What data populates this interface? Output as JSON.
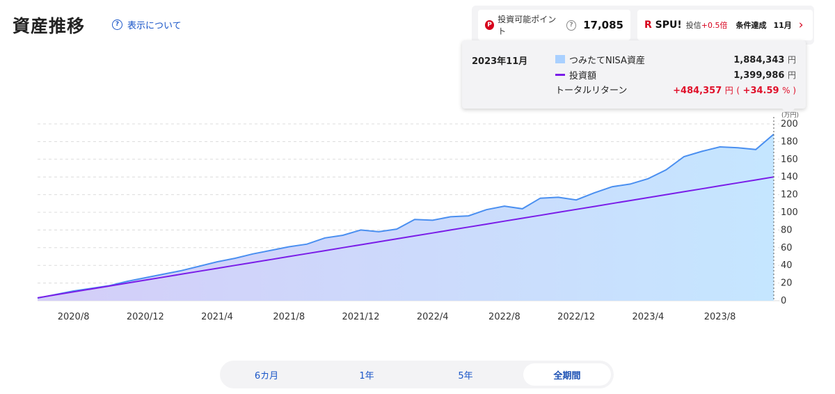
{
  "header": {
    "title": "資産推移",
    "about_link": "表示について"
  },
  "points_card": {
    "label": "投資可能ポイント",
    "value": "17,085"
  },
  "spu_card": {
    "logo": "SPU!",
    "type": "投信",
    "plus": "+0.5倍",
    "condition": "条件達成",
    "month": "11月"
  },
  "tooltip": {
    "date": "2023年11月",
    "asset_label": "つみたてNISA資産",
    "asset_value": "1,884,343",
    "invest_label": "投資額",
    "invest_value": "1,399,986",
    "return_label": "トータルリターン",
    "return_value": "+484,357",
    "return_pct": "+34.59",
    "unit_yen": "円",
    "pct_unit": "%"
  },
  "chart_data": {
    "type": "area",
    "unit_label": "(万円)",
    "ylim": [
      0,
      200
    ],
    "y_ticks": [
      0,
      20,
      40,
      60,
      80,
      100,
      120,
      140,
      160,
      180,
      200
    ],
    "x_tick_labels": [
      "2020/8",
      "2020/12",
      "2021/4",
      "2021/8",
      "2021/12",
      "2022/4",
      "2022/8",
      "2022/12",
      "2023/4",
      "2023/8"
    ],
    "x_tick_index": [
      2,
      6,
      10,
      14,
      18,
      22,
      26,
      30,
      34,
      38
    ],
    "categories": [
      "2020/6",
      "2020/7",
      "2020/8",
      "2020/9",
      "2020/10",
      "2020/11",
      "2020/12",
      "2021/1",
      "2021/2",
      "2021/3",
      "2021/4",
      "2021/5",
      "2021/6",
      "2021/7",
      "2021/8",
      "2021/9",
      "2021/10",
      "2021/11",
      "2021/12",
      "2022/1",
      "2022/2",
      "2022/3",
      "2022/4",
      "2022/5",
      "2022/6",
      "2022/7",
      "2022/8",
      "2022/9",
      "2022/10",
      "2022/11",
      "2022/12",
      "2023/1",
      "2023/2",
      "2023/3",
      "2023/4",
      "2023/5",
      "2023/6",
      "2023/7",
      "2023/8",
      "2023/9",
      "2023/10",
      "2023/11"
    ],
    "series": [
      {
        "name": "つみたてNISA資産",
        "color": "#4a8ff0",
        "values": [
          3,
          7,
          11,
          14,
          17,
          22,
          26,
          30,
          34,
          39,
          44,
          48,
          53,
          57,
          61,
          64,
          71,
          74,
          80,
          78,
          81,
          92,
          91,
          95,
          96,
          103,
          107,
          104,
          116,
          117,
          114,
          122,
          129,
          132,
          138,
          148,
          163,
          169,
          174,
          173,
          171,
          188.4
        ]
      },
      {
        "name": "投資額",
        "color": "#7a1de8",
        "values": [
          3.3,
          6.7,
          10.0,
          13.3,
          16.6,
          20.0,
          23.3,
          26.6,
          30.0,
          33.3,
          36.6,
          40.0,
          43.3,
          46.6,
          50.0,
          53.3,
          56.6,
          60.0,
          63.3,
          66.6,
          70.0,
          73.3,
          76.6,
          80.0,
          83.3,
          86.6,
          90.0,
          93.3,
          96.6,
          100.0,
          103.3,
          106.6,
          110.0,
          113.3,
          116.6,
          120.0,
          123.3,
          126.6,
          130.0,
          133.3,
          136.6,
          140.0
        ]
      }
    ],
    "grid": true
  },
  "tabs": [
    {
      "label": "6カ月",
      "active": false
    },
    {
      "label": "1年",
      "active": false
    },
    {
      "label": "5年",
      "active": false
    },
    {
      "label": "全期間",
      "active": true
    }
  ]
}
